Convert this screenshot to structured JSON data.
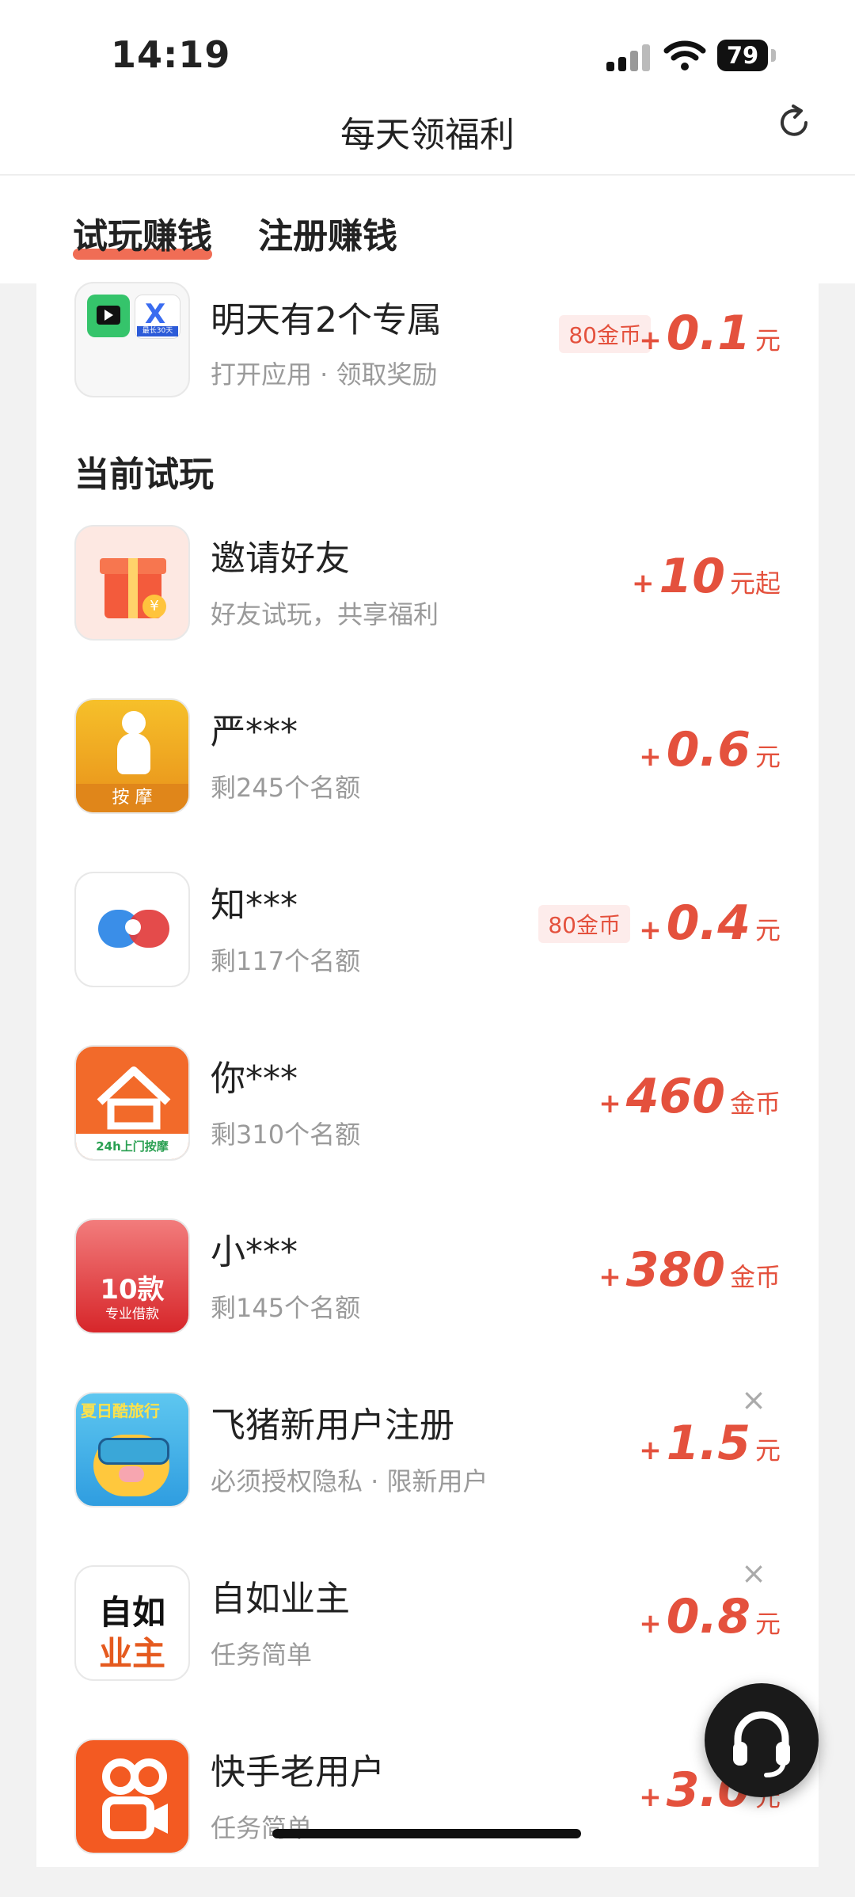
{
  "status_bar": {
    "time": "14:19",
    "battery": "79"
  },
  "nav": {
    "title": "每天领福利"
  },
  "tabs": [
    {
      "label": "试玩赚钱"
    },
    {
      "label": "注册赚钱"
    }
  ],
  "top_item": {
    "title": "明天有2个专属",
    "subtitle": "打开应用 · 领取奖励",
    "badge": "80金币",
    "plus": "+",
    "amount": "0.1",
    "unit": "元",
    "icon_badge_text": "最长30天"
  },
  "section_title": "当前试玩",
  "items": [
    {
      "title": "邀请好友",
      "subtitle": "好友试玩，共享福利",
      "plus": "+",
      "amount": "10",
      "unit": "元起",
      "icon": "gift-icon",
      "icon_text": "¥"
    },
    {
      "title": "严***",
      "subtitle": "剩245个名额",
      "plus": "+",
      "amount": "0.6",
      "unit": "元",
      "icon": "massage-app-icon",
      "icon_text": "按 摩"
    },
    {
      "title": "知***",
      "subtitle": "剩117个名额",
      "badge": "80金币",
      "plus": "+",
      "amount": "0.4",
      "unit": "元",
      "icon": "chat-bubbles-icon"
    },
    {
      "title": "你***",
      "subtitle": "剩310个名额",
      "plus": "+",
      "amount": "460",
      "unit": "金币",
      "icon": "house-icon",
      "icon_text": "24h上门按摩"
    },
    {
      "title": "小***",
      "subtitle": "剩145个名额",
      "plus": "+",
      "amount": "380",
      "unit": "金币",
      "icon": "loan-app-icon",
      "icon_text_top": "10款",
      "icon_text": "专业借款"
    },
    {
      "title": "飞猪新用户注册",
      "subtitle": "必须授权隐私 · 限新用户",
      "plus": "+",
      "amount": "1.5",
      "unit": "元",
      "icon": "fliggy-pig-icon",
      "icon_text": "夏日酷旅行",
      "closable": true,
      "close": "×"
    },
    {
      "title": "自如业主",
      "subtitle": "任务简单",
      "plus": "+",
      "amount": "0.8",
      "unit": "元",
      "icon": "ziroom-icon",
      "icon_text_top": "自如",
      "icon_text": "业主",
      "closable": true,
      "close": "×"
    },
    {
      "title": "快手老用户",
      "subtitle": "任务简单",
      "plus": "+",
      "amount": "3.0",
      "unit": "元",
      "icon": "kuaishou-icon"
    }
  ],
  "colors": {
    "accent": "#e4513d",
    "tab_underline": "#f06d55",
    "background": "#f2f2f2"
  }
}
